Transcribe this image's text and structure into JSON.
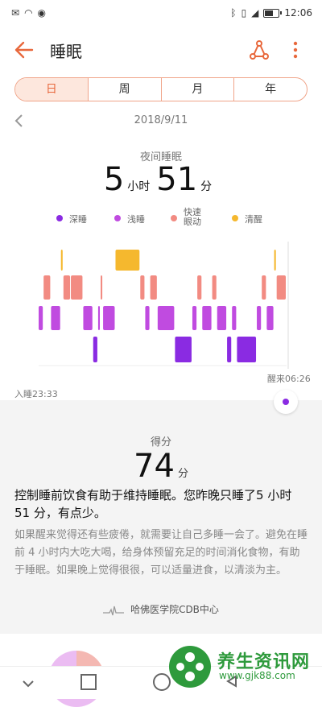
{
  "status": {
    "time": "12:06"
  },
  "header": {
    "title": "睡眠"
  },
  "tabs": [
    "日",
    "周",
    "月",
    "年"
  ],
  "date": "2018/9/11",
  "summary": {
    "label": "夜间睡眠",
    "hours": "5",
    "hours_unit": "小时",
    "minutes": "51",
    "minutes_unit": "分"
  },
  "legend": [
    {
      "label": "深睡",
      "color": "#8a2be2"
    },
    {
      "label": "浅睡",
      "color": "#c04be0"
    },
    {
      "label": "快速眼动",
      "color": "#f28b82"
    },
    {
      "label": "清醒",
      "color": "#f5b82e"
    }
  ],
  "sleep_time_label": "入睡23:33",
  "wake_time_label": "醒来06:26",
  "score": {
    "label": "得分",
    "value": "74",
    "unit": "分"
  },
  "advice_main": "控制睡前饮食有助于维持睡眠。您昨晚只睡了5 小时 51 分，有点少。",
  "advice_detail": "如果醒来觉得还有些疲倦，就需要让自己多睡一会了。避免在睡前 4 小时内大吃大喝，给身体预留充足的时间消化食物，有助于睡眠。如果晚上觉得很很，可以适量进食，以清淡为主。",
  "source": "哈佛医学院CDB中心",
  "watermark": {
    "title": "养生资讯网",
    "url": "www.gjk88.com"
  },
  "chart_data": {
    "type": "bar",
    "stage_levels": {
      "清醒": 4,
      "快速眼动": 3,
      "浅睡": 2,
      "深睡": 1
    },
    "start": "23:33",
    "end": "06:26",
    "segments": [
      {
        "stage": "浅睡",
        "start": 0.0,
        "end": 0.02
      },
      {
        "stage": "快速眼动",
        "start": 0.02,
        "end": 0.05
      },
      {
        "stage": "浅睡",
        "start": 0.05,
        "end": 0.09
      },
      {
        "stage": "清醒",
        "start": 0.09,
        "end": 0.1
      },
      {
        "stage": "快速眼动",
        "start": 0.1,
        "end": 0.13
      },
      {
        "stage": "快速眼动",
        "start": 0.13,
        "end": 0.18
      },
      {
        "stage": "浅睡",
        "start": 0.18,
        "end": 0.22
      },
      {
        "stage": "深睡",
        "start": 0.22,
        "end": 0.24
      },
      {
        "stage": "浅睡",
        "start": 0.24,
        "end": 0.25
      },
      {
        "stage": "快速眼动",
        "start": 0.25,
        "end": 0.26
      },
      {
        "stage": "浅睡",
        "start": 0.26,
        "end": 0.31
      },
      {
        "stage": "清醒",
        "start": 0.31,
        "end": 0.41
      },
      {
        "stage": "快速眼动",
        "start": 0.41,
        "end": 0.43
      },
      {
        "stage": "浅睡",
        "start": 0.43,
        "end": 0.45
      },
      {
        "stage": "快速眼动",
        "start": 0.45,
        "end": 0.48
      },
      {
        "stage": "浅睡",
        "start": 0.48,
        "end": 0.55
      },
      {
        "stage": "深睡",
        "start": 0.55,
        "end": 0.62
      },
      {
        "stage": "浅睡",
        "start": 0.62,
        "end": 0.64
      },
      {
        "stage": "快速眼动",
        "start": 0.64,
        "end": 0.66
      },
      {
        "stage": "浅睡",
        "start": 0.66,
        "end": 0.7
      },
      {
        "stage": "快速眼动",
        "start": 0.7,
        "end": 0.72
      },
      {
        "stage": "浅睡",
        "start": 0.72,
        "end": 0.76
      },
      {
        "stage": "深睡",
        "start": 0.76,
        "end": 0.78
      },
      {
        "stage": "浅睡",
        "start": 0.78,
        "end": 0.8
      },
      {
        "stage": "深睡",
        "start": 0.8,
        "end": 0.88
      },
      {
        "stage": "浅睡",
        "start": 0.88,
        "end": 0.9
      },
      {
        "stage": "快速眼动",
        "start": 0.9,
        "end": 0.92
      },
      {
        "stage": "浅睡",
        "start": 0.92,
        "end": 0.95
      },
      {
        "stage": "清醒",
        "start": 0.95,
        "end": 0.96
      },
      {
        "stage": "快速眼动",
        "start": 0.96,
        "end": 1.0
      }
    ]
  }
}
